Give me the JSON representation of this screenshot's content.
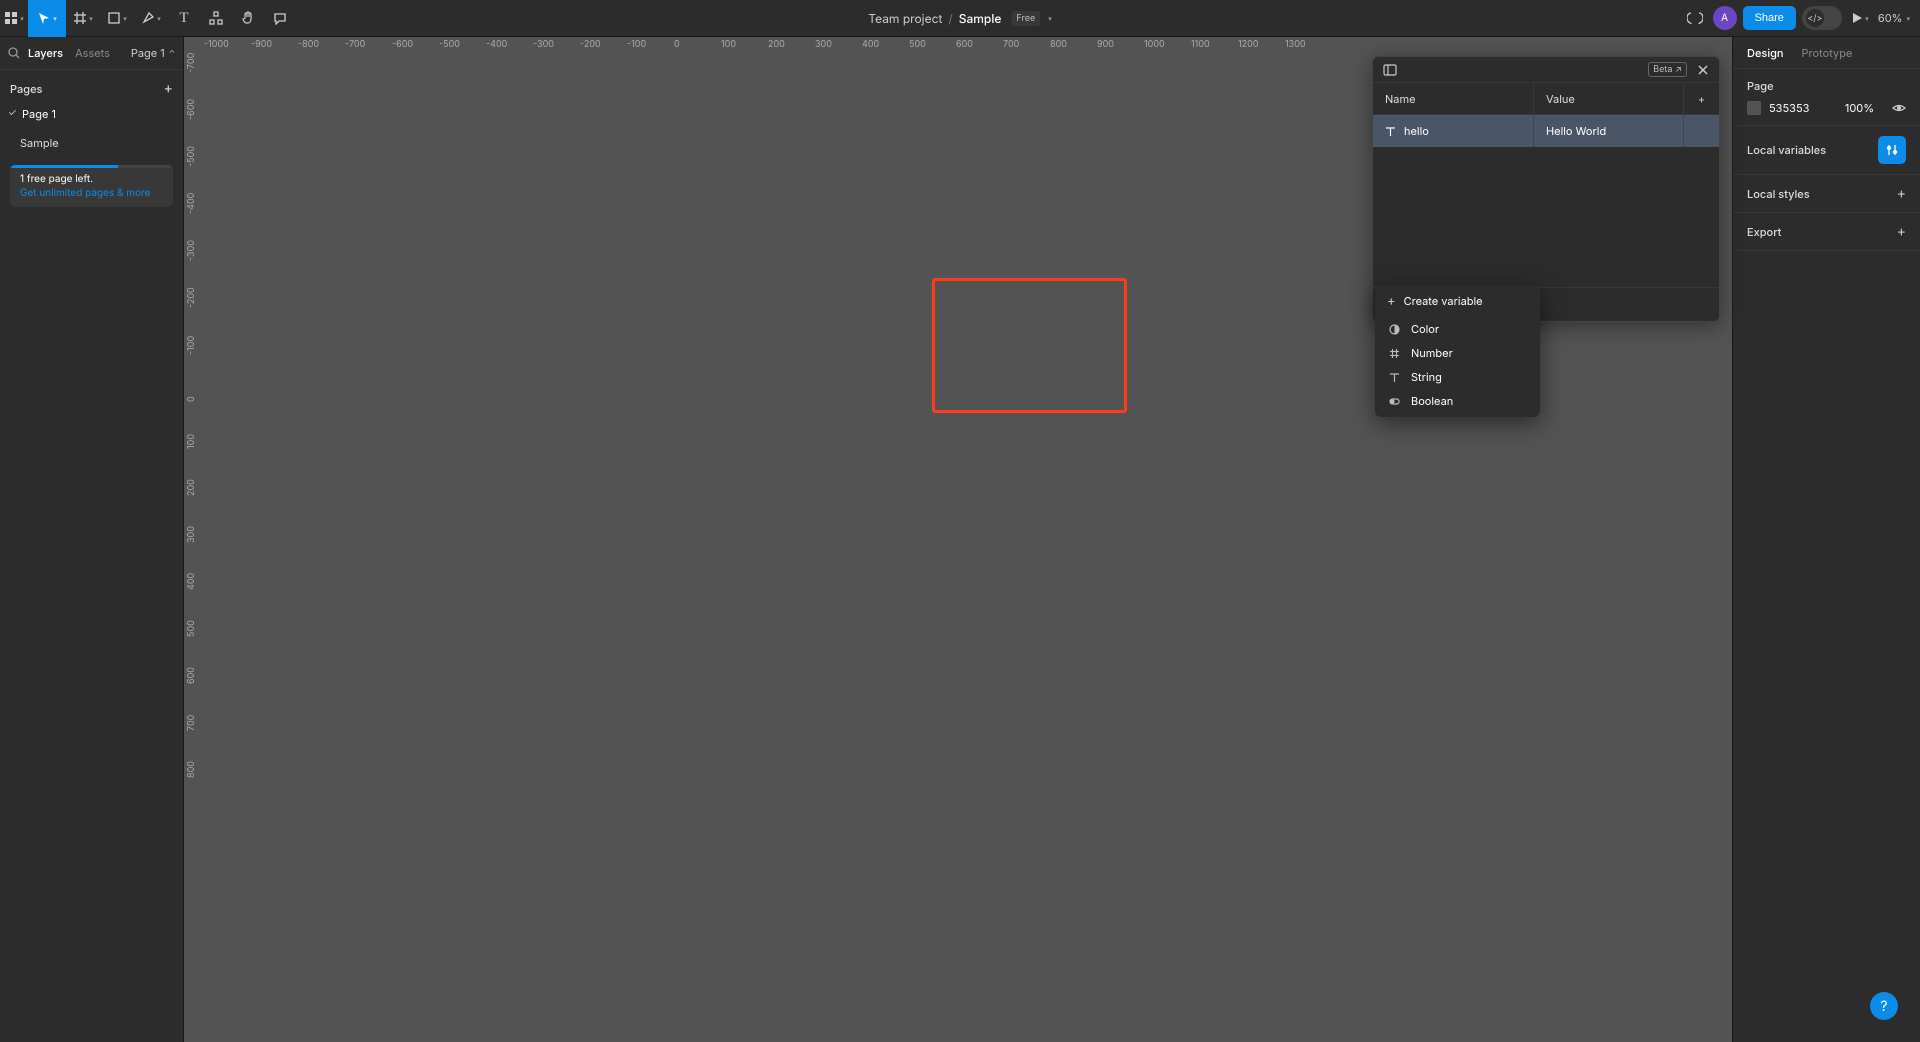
{
  "toolbar": {
    "project": "Team project",
    "file": "Sample",
    "plan_badge": "Free",
    "share_label": "Share",
    "zoom": "60%"
  },
  "left_panel": {
    "tabs": {
      "layers": "Layers",
      "assets": "Assets"
    },
    "page_selector": "Page 1",
    "pages_header": "Pages",
    "pages": [
      {
        "name": "Page 1"
      }
    ],
    "layers": [
      {
        "name": "Sample"
      }
    ],
    "promo": {
      "line1": "1 free page left.",
      "line2": "Get unlimited pages & more"
    }
  },
  "ruler": {
    "h": [
      "-1000",
      "-900",
      "-800",
      "-700",
      "-600",
      "-500",
      "-400",
      "-300",
      "-200",
      "-100",
      "0",
      "100",
      "200",
      "300",
      "400",
      "500",
      "600",
      "700",
      "800",
      "900",
      "1000",
      "1100",
      "1200",
      "1300"
    ],
    "v": [
      "-700",
      "-600",
      "-500",
      "-400",
      "-300",
      "-200",
      "-100",
      "0",
      "100",
      "200",
      "300",
      "400",
      "500",
      "600",
      "700",
      "800"
    ]
  },
  "right_panel": {
    "tabs": {
      "design": "Design",
      "prototype": "Prototype"
    },
    "page_label": "Page",
    "page_color": "535353",
    "page_opacity": "100%",
    "local_variables": "Local variables",
    "local_styles": "Local styles",
    "export": "Export"
  },
  "vars_panel": {
    "beta": "Beta",
    "name_header": "Name",
    "value_header": "Value",
    "rows": [
      {
        "name": "hello",
        "value": "Hello World",
        "type_icon": "text"
      }
    ]
  },
  "create_popover": {
    "header": "Create variable",
    "items": [
      {
        "label": "Color",
        "icon": "color"
      },
      {
        "label": "Number",
        "icon": "number"
      },
      {
        "label": "String",
        "icon": "string"
      },
      {
        "label": "Boolean",
        "icon": "boolean"
      }
    ]
  }
}
